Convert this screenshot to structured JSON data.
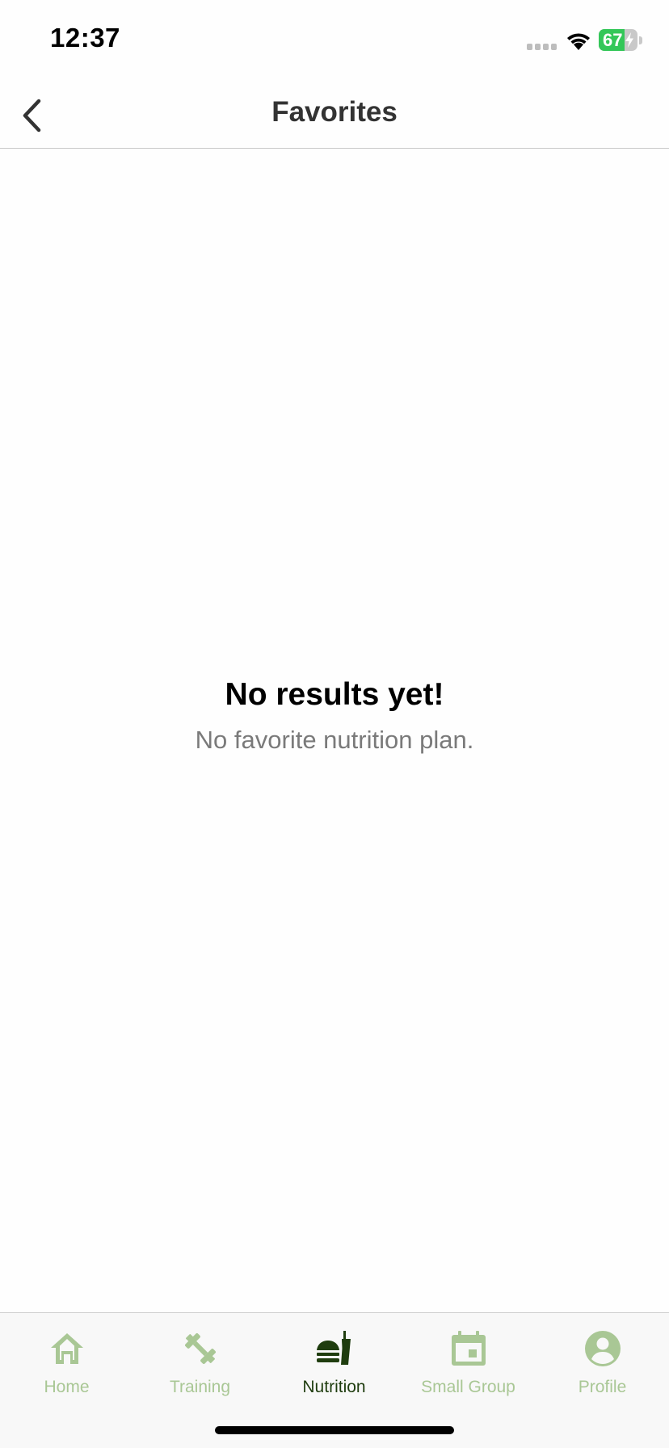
{
  "status_bar": {
    "time": "12:37",
    "battery": "67",
    "battery_level": 0.67
  },
  "nav": {
    "title": "Favorites"
  },
  "empty_state": {
    "title": "No results yet!",
    "subtitle": "No favorite nutrition plan."
  },
  "tabs": [
    {
      "label": "Home",
      "icon": "home-icon",
      "active": false
    },
    {
      "label": "Training",
      "icon": "dumbbell-icon",
      "active": false
    },
    {
      "label": "Nutrition",
      "icon": "fastfood-icon",
      "active": true
    },
    {
      "label": "Small Group",
      "icon": "calendar-icon",
      "active": false
    },
    {
      "label": "Profile",
      "icon": "profile-icon",
      "active": false
    }
  ],
  "colors": {
    "tab_inactive": "#a9c795",
    "tab_active": "#1f3d0f",
    "battery_green": "#34c759"
  }
}
